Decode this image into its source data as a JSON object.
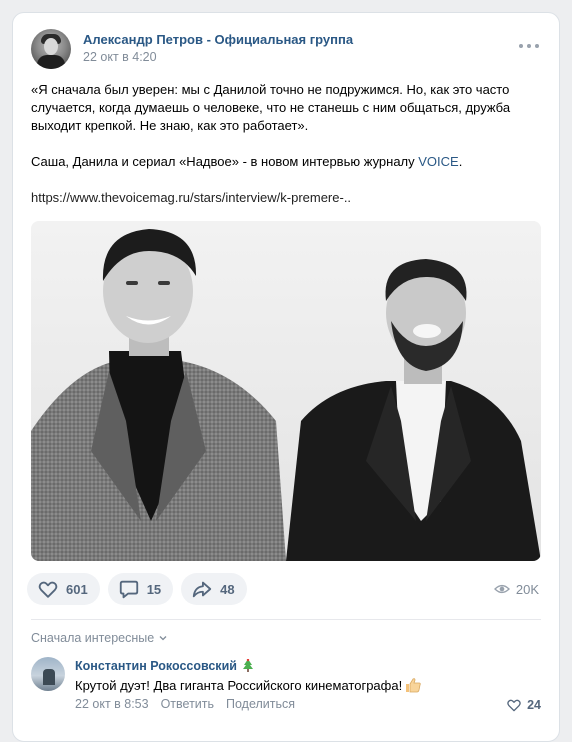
{
  "post": {
    "author": "Александр Петров - Официальная группа",
    "date": "22 окт в 4:20",
    "text_quote": "«Я сначала был уверен: мы с Данилой точно не подружимся. Но, как это часто случается, когда думаешь о человеке, что не станешь с ним общаться, дружба выходит крепкой. Не знаю, как это работает».",
    "text_line2_prefix": "Саша, Данила и сериал «Надвое» - в новом интервью журналу ",
    "text_line2_link": "VOICE",
    "text_line2_suffix": ".",
    "url": "https://www.thevoicemag.ru/stars/interview/k-premere-.."
  },
  "actions": {
    "likes": "601",
    "comments": "15",
    "shares": "48",
    "views": "20K"
  },
  "comments": {
    "sort_label": "Сначала интересные",
    "items": [
      {
        "author": "Константин Рокоссовский",
        "text": "Крутой дуэт! Два гиганта Российского кинематографа!",
        "date": "22 окт в 8:53",
        "reply_label": "Ответить",
        "share_label": "Поделиться",
        "likes": "24"
      }
    ]
  },
  "icons": {
    "more": "more-horizontal-icon",
    "like": "heart-icon",
    "comment": "comment-icon",
    "share": "share-icon",
    "views": "eye-icon",
    "chevron": "chevron-down-icon",
    "emoji": "thumbs-up-icon",
    "badge": "fir-tree-icon"
  },
  "colors": {
    "link": "#2a5885",
    "secondary": "#818c99",
    "action_bg": "#f0f2f5",
    "action_text": "#55677d"
  }
}
